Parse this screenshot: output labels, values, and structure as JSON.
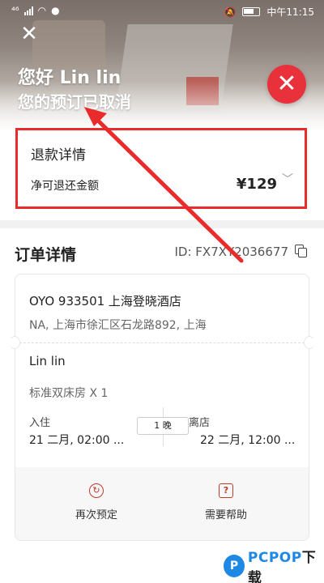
{
  "status_bar": {
    "network": "⁴⁶",
    "time": "中午11:15"
  },
  "header": {
    "greeting": "您好 Lin lin",
    "message": "您的预订已取消",
    "close_icon": "close-icon",
    "status_icon": "cancelled-x-icon",
    "status_color": "#e8313b"
  },
  "refund": {
    "title": "退款详情",
    "label": "净可退还金额",
    "amount": "¥129"
  },
  "order": {
    "title": "订单详情",
    "id_text": "ID: FX7XY2036677",
    "hotel_name": "OYO 933501 上海登晓酒店",
    "hotel_address": "NA, 上海市徐汇区石龙路892, 上海",
    "guest": "Lin lin",
    "room": "标准双床房 X 1",
    "checkin_label": "入住",
    "checkin_value": "21 二月, 02:00 ...",
    "checkout_label": "离店",
    "checkout_value": "22 二月, 12:00 ...",
    "nights": "1 晚"
  },
  "actions": {
    "rebook": "再次预定",
    "help": "需要帮助"
  },
  "watermark": {
    "brand_left": "PCPOP",
    "brand_right": "下载"
  },
  "accent_colors": {
    "highlight_box": "#ea2b2b",
    "arrow": "#ea2b2b"
  }
}
